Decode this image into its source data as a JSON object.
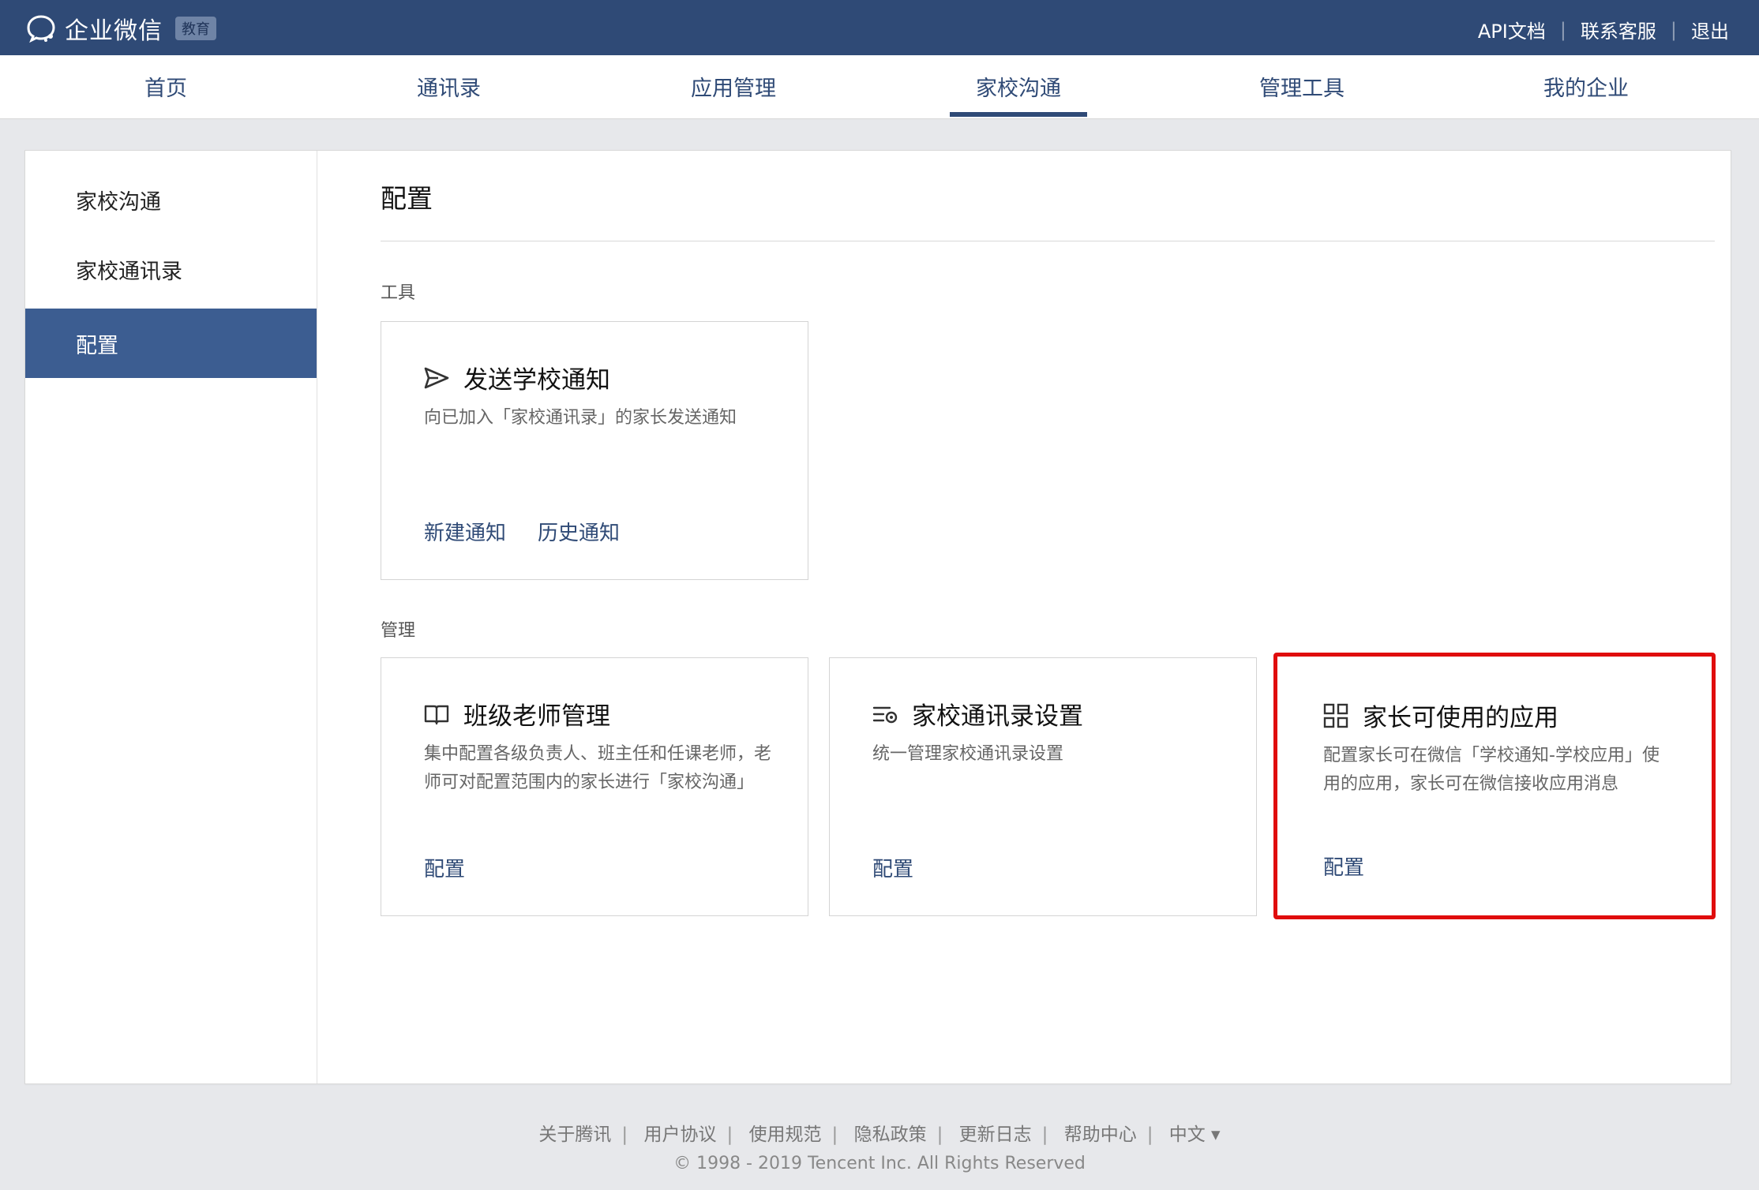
{
  "header": {
    "product_name": "企业微信",
    "product_badge": "教育",
    "links": [
      "API文档",
      "联系客服",
      "退出"
    ]
  },
  "nav": {
    "tabs": [
      "首页",
      "通讯录",
      "应用管理",
      "家校沟通",
      "管理工具",
      "我的企业"
    ],
    "active_tab": "家校沟通"
  },
  "sidebar": {
    "items": [
      "家校沟通",
      "家校通讯录",
      "配置"
    ],
    "active_item": "配置"
  },
  "content": {
    "title": "配置",
    "sections": [
      {
        "label": "工具",
        "cards": [
          {
            "title": "发送学校通知",
            "description": "向已加入「家校通讯录」的家长发送通知",
            "actions": [
              "新建通知",
              "历史通知"
            ],
            "icon": "send-icon"
          }
        ]
      },
      {
        "label": "管理",
        "cards": [
          {
            "title": "班级老师管理",
            "description": "集中配置各级负责人、班主任和任课老师，老师可对配置范围内的家长进行「家校沟通」",
            "actions": [
              "配置"
            ],
            "icon": "book-icon"
          },
          {
            "title": "家校通讯录设置",
            "description": "统一管理家校通讯录设置",
            "actions": [
              "配置"
            ],
            "icon": "list-settings-icon"
          },
          {
            "title": "家长可使用的应用",
            "description": "配置家长可在微信「学校通知-学校应用」使用的应用，家长可在微信接收应用消息",
            "actions": [
              "配置"
            ],
            "icon": "apps-grid-icon"
          }
        ]
      }
    ]
  },
  "footer": {
    "links": [
      "关于腾讯",
      "用户协议",
      "使用规范",
      "隐私政策",
      "更新日志",
      "帮助中心",
      "中文 ▾"
    ],
    "copyright": "© 1998 - 2019 Tencent Inc. All Rights Reserved"
  },
  "colors": {
    "header_bg": "#2f4a76",
    "active_sidebar_bg": "#3c5d91",
    "link": "#2f4a76",
    "highlight_border": "#e00d0d"
  }
}
